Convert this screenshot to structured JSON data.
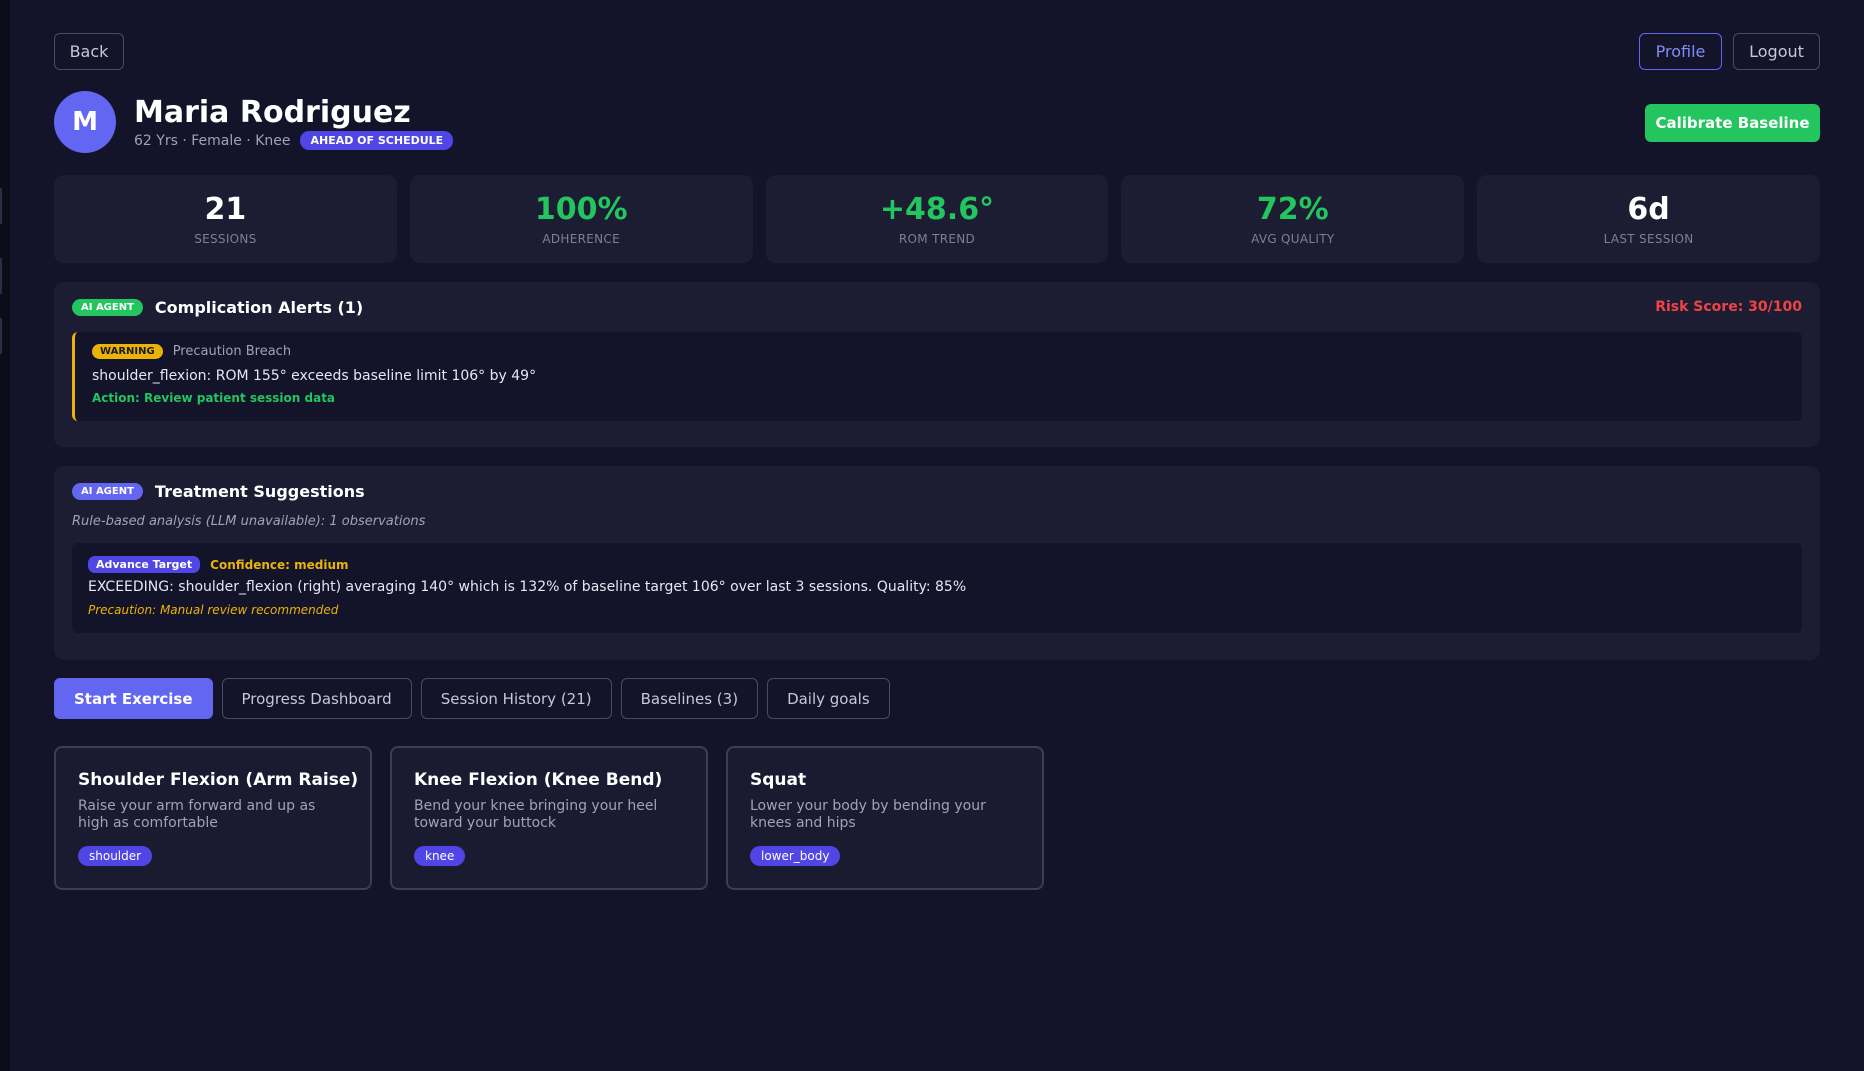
{
  "header": {
    "back_label": "Back",
    "profile_label": "Profile",
    "logout_label": "Logout"
  },
  "patient": {
    "avatar_initial": "M",
    "name": "Maria Rodriguez",
    "meta": "62 Yrs · Female · Knee",
    "status_badge": "AHEAD OF SCHEDULE",
    "calibrate_label": "Calibrate Baseline"
  },
  "stats": [
    {
      "value": "21",
      "label": "SESSIONS"
    },
    {
      "value": "100%",
      "label": "ADHERENCE"
    },
    {
      "value": "+48.6°",
      "label": "ROM TREND"
    },
    {
      "value": "72%",
      "label": "AVG QUALITY"
    },
    {
      "value": "6d",
      "label": "LAST SESSION"
    }
  ],
  "alerts": {
    "badge": "AI AGENT",
    "title": "Complication Alerts (1)",
    "risk_score": "Risk Score: 30/100",
    "items": [
      {
        "level": "WARNING",
        "type": "Precaution Breach",
        "message": "shoulder_flexion: ROM 155° exceeds baseline limit 106° by 49°",
        "action": "Action: Review patient session data"
      }
    ]
  },
  "treatment": {
    "badge": "AI AGENT",
    "title": "Treatment Suggestions",
    "subtitle": "Rule-based analysis (LLM unavailable): 1 observations",
    "items": [
      {
        "tag": "Advance Target",
        "confidence": "Confidence: medium",
        "message": "EXCEEDING: shoulder_flexion (right) averaging 140° which is 132% of baseline target 106° over last 3 sessions. Quality: 85%",
        "precaution": "Precaution: Manual review recommended"
      }
    ]
  },
  "tabs": [
    {
      "label": "Start Exercise",
      "active": true
    },
    {
      "label": "Progress Dashboard"
    },
    {
      "label": "Session History (21)"
    },
    {
      "label": "Baselines (3)"
    },
    {
      "label": "Daily goals"
    }
  ],
  "exercises": [
    {
      "title": "Shoulder Flexion (Arm Raise)",
      "description": "Raise your arm forward and up as high as comfortable",
      "tag": "shoulder"
    },
    {
      "title": "Knee Flexion (Knee Bend)",
      "description": "Bend your knee bringing your heel toward your buttock",
      "tag": "knee"
    },
    {
      "title": "Squat",
      "description": "Lower your body by bending your knees and hips",
      "tag": "lower_body"
    }
  ],
  "colors": {
    "background": "#13132a",
    "card": "#1c1c33",
    "accent": "#6366f1",
    "success": "#22c55e",
    "warning": "#eab308",
    "danger": "#ef4444"
  }
}
